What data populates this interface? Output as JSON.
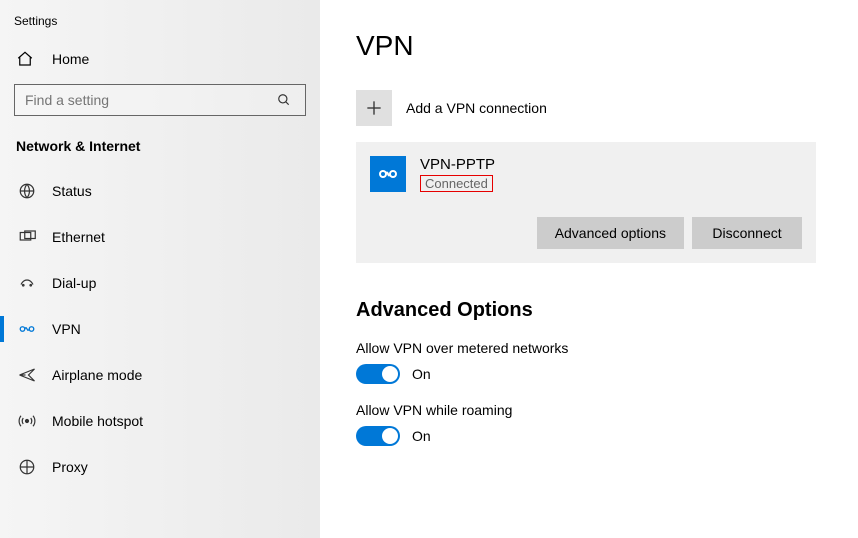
{
  "appTitle": "Settings",
  "home": "Home",
  "searchPlaceholder": "Find a setting",
  "sectionTitle": "Network & Internet",
  "nav": {
    "status": "Status",
    "ethernet": "Ethernet",
    "dialup": "Dial-up",
    "vpn": "VPN",
    "airplane": "Airplane mode",
    "hotspot": "Mobile hotspot",
    "proxy": "Proxy"
  },
  "page": {
    "title": "VPN",
    "addLabel": "Add a VPN connection",
    "connection": {
      "name": "VPN-PPTP",
      "status": "Connected"
    },
    "buttons": {
      "advanced": "Advanced options",
      "disconnect": "Disconnect"
    },
    "advTitle": "Advanced Options",
    "meteredLabel": "Allow VPN over metered networks",
    "meteredState": "On",
    "roamingLabel": "Allow VPN while roaming",
    "roamingState": "On"
  }
}
